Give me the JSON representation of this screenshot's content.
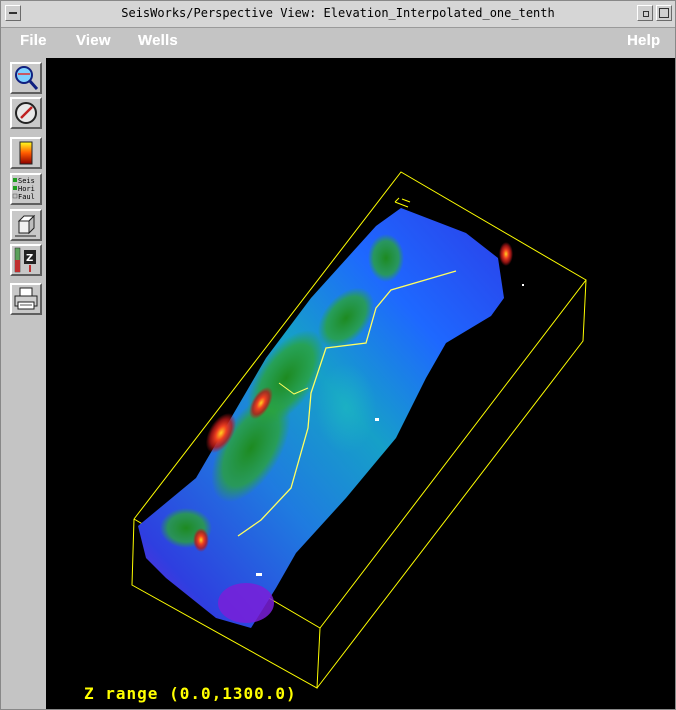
{
  "window": {
    "title": "SeisWorks/Perspective View: Elevation_Interpolated_one_tenth"
  },
  "menubar": {
    "file": "File",
    "view": "View",
    "wells": "Wells",
    "help": "Help"
  },
  "toolbar": {
    "tools": [
      {
        "name": "zoom-tool",
        "icon": "magnifier-icon"
      },
      {
        "name": "rotate-tool",
        "icon": "gauge-icon"
      },
      {
        "name": "colorbar-tool",
        "icon": "colorbar-icon"
      },
      {
        "name": "layers-tool",
        "icon": "layers-icon",
        "lines": [
          "Seis",
          "Hori",
          "Faul"
        ]
      },
      {
        "name": "cube-tool",
        "icon": "cube-icon"
      },
      {
        "name": "z-scale-tool",
        "icon": "z-scale-icon",
        "label": "Z"
      },
      {
        "name": "print-tool",
        "icon": "printer-icon"
      }
    ]
  },
  "viewport": {
    "z_range_label": "Z range (0.0,1300.0)",
    "colors": {
      "background": "#000000",
      "box": "#ffff00",
      "surface_low": "#7a1fd8",
      "surface_mid": "#1e5cff",
      "surface_high": "#e01b1b"
    }
  }
}
